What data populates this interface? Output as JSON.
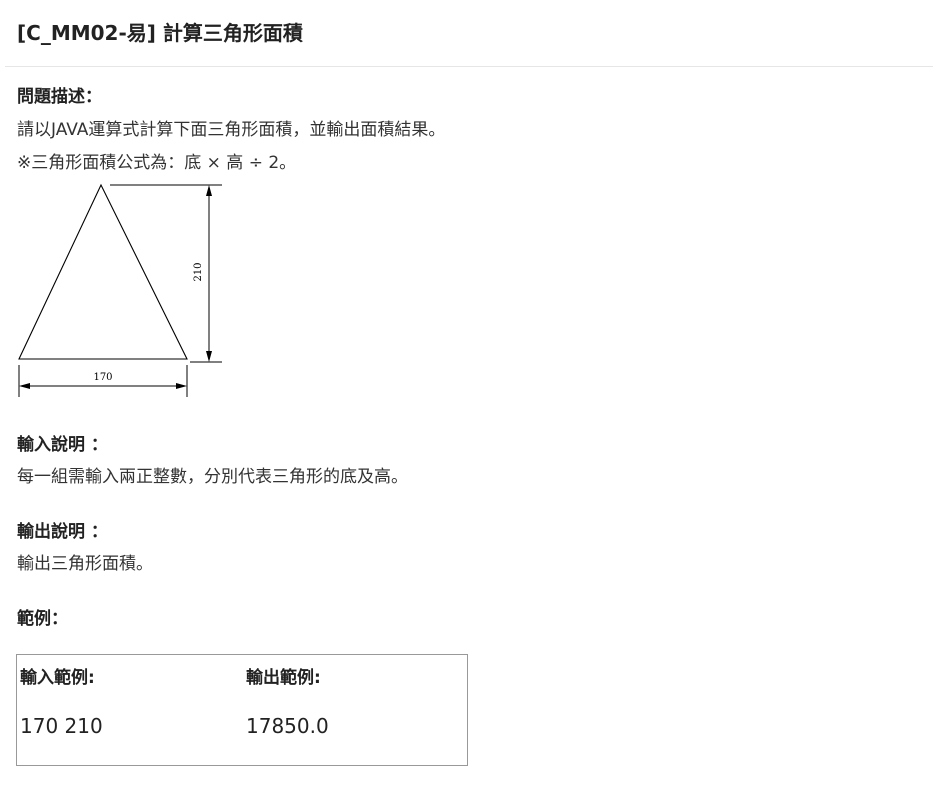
{
  "title": "[C_MM02-易] 計算三角形面積",
  "description": {
    "heading": "問題描述：",
    "line1": "請以JAVA運算式計算下面三角形面積，並輸出面積結果。",
    "line2": "※三角形面積公式為：底 × 高 ÷ 2。"
  },
  "figure": {
    "height_label": "210",
    "base_label": "170"
  },
  "input_section": {
    "heading": "輸入說明 ：",
    "text": "每一組需輸入兩正整數，分別代表三角形的底及高。"
  },
  "output_section": {
    "heading": "輸出說明 ：",
    "text": "輸出三角形面積。"
  },
  "examples": {
    "heading": "範例：",
    "input_header": "輸入範例:",
    "output_header": "輸出範例:",
    "input_value": "170 210",
    "output_value": "17850.0"
  }
}
